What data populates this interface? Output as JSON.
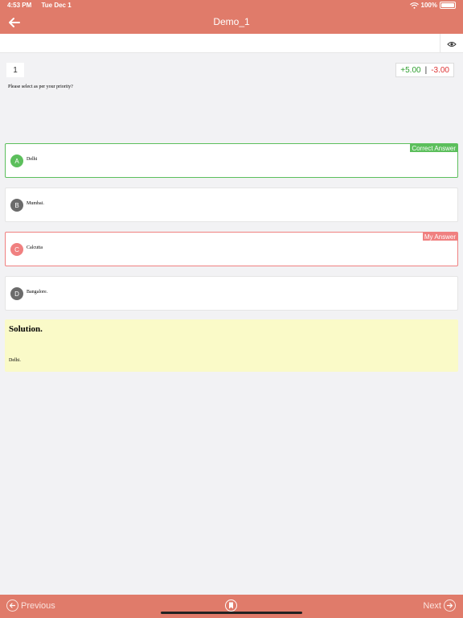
{
  "status_bar": {
    "time": "4:53 PM",
    "date": "Tue Dec 1",
    "battery": "100%"
  },
  "header": {
    "title": "Demo_1"
  },
  "question": {
    "number": "1",
    "positive_marks": "+5.00",
    "separator": "|",
    "negative_marks": "-3.00",
    "text": "Please select as per your priority?"
  },
  "options": [
    {
      "letter": "A",
      "text": "Delhi",
      "tag": "Correct Answer"
    },
    {
      "letter": "B",
      "text": "Mumbai."
    },
    {
      "letter": "C",
      "text": "Calcutta",
      "tag": "My Answer"
    },
    {
      "letter": "D",
      "text": "Bangalore."
    }
  ],
  "solution": {
    "title": "Solution.",
    "text": "Delhi."
  },
  "footer": {
    "previous_label": "Previous",
    "next_label": "Next"
  },
  "colors": {
    "header": "#e07b6a",
    "correct": "#5cbf5c",
    "my_answer": "#f08080",
    "option_neutral": "#6b6b6b",
    "solution_bg": "#fafac8"
  },
  "icons": {
    "back": "back-arrow-icon",
    "eye": "eye-icon",
    "wifi": "wifi-icon",
    "battery": "battery-icon",
    "previous": "arrow-left-circle-icon",
    "next": "arrow-right-circle-icon",
    "bookmark": "bookmark-icon"
  }
}
